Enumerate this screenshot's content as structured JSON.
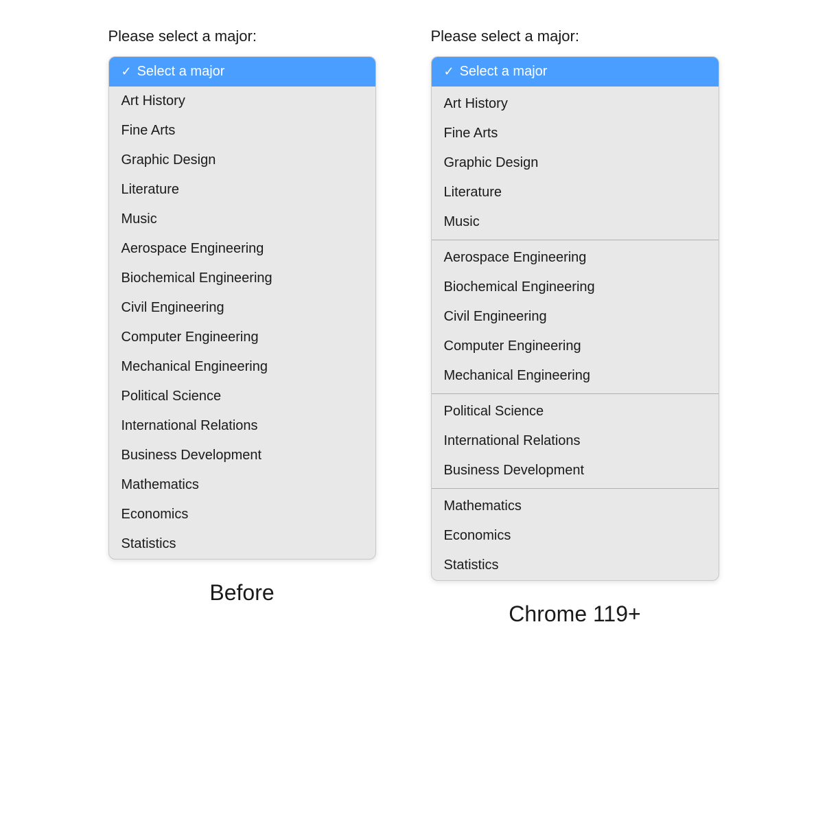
{
  "left": {
    "prompt": "Please select a major:",
    "caption": "Before",
    "selected_label": "Select a major",
    "items": [
      {
        "label": "Art History"
      },
      {
        "label": "Fine Arts"
      },
      {
        "label": "Graphic Design"
      },
      {
        "label": "Literature"
      },
      {
        "label": "Music"
      },
      {
        "label": "Aerospace Engineering"
      },
      {
        "label": "Biochemical Engineering"
      },
      {
        "label": "Civil Engineering"
      },
      {
        "label": "Computer Engineering"
      },
      {
        "label": "Mechanical Engineering"
      },
      {
        "label": "Political Science"
      },
      {
        "label": "International Relations"
      },
      {
        "label": "Business Development"
      },
      {
        "label": "Mathematics"
      },
      {
        "label": "Economics"
      },
      {
        "label": "Statistics"
      }
    ]
  },
  "right": {
    "prompt": "Please select a major:",
    "caption": "Chrome 119+",
    "selected_label": "Select a major",
    "groups": [
      {
        "items": []
      },
      {
        "items": [
          {
            "label": "Art History"
          },
          {
            "label": "Fine Arts"
          },
          {
            "label": "Graphic Design"
          },
          {
            "label": "Literature"
          },
          {
            "label": "Music"
          }
        ]
      },
      {
        "items": [
          {
            "label": "Aerospace Engineering"
          },
          {
            "label": "Biochemical Engineering"
          },
          {
            "label": "Civil Engineering"
          },
          {
            "label": "Computer Engineering"
          },
          {
            "label": "Mechanical Engineering"
          }
        ]
      },
      {
        "items": [
          {
            "label": "Political Science"
          },
          {
            "label": "International Relations"
          },
          {
            "label": "Business Development"
          }
        ]
      },
      {
        "items": [
          {
            "label": "Mathematics"
          },
          {
            "label": "Economics"
          },
          {
            "label": "Statistics"
          }
        ]
      }
    ]
  },
  "icons": {
    "checkmark": "✓"
  }
}
